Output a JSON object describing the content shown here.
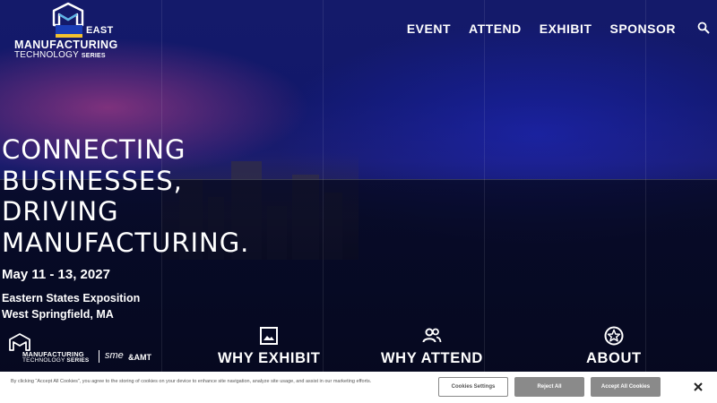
{
  "header": {
    "logo": {
      "badge": "EAST",
      "line1": "MANUFACTURING",
      "line2": "TECHNOLOGY",
      "line2_suffix": "SERIES"
    },
    "nav": [
      {
        "label": "EVENT"
      },
      {
        "label": "ATTEND"
      },
      {
        "label": "EXHIBIT"
      },
      {
        "label": "SPONSOR"
      }
    ],
    "search_icon": "search-icon"
  },
  "hero": {
    "headline": [
      "CONNECTING",
      "BUSINESSES,",
      "DRIVING",
      "MANUFACTURING."
    ],
    "dates": "May 11 - 13, 2027",
    "venue_line1": "Eastern States Exposition",
    "venue_line2": "West Springfield, MA"
  },
  "footer_logo": {
    "line1": "MANUFACTURING",
    "line2": "TECHNOLOGY",
    "line2_suffix": "SERIES",
    "partner1": "sme",
    "partner2": "&AMT"
  },
  "ctas": [
    {
      "label": "WHY EXHIBIT",
      "icon": "image-icon"
    },
    {
      "label": "WHY ATTEND",
      "icon": "people-icon"
    },
    {
      "label": "ABOUT",
      "icon": "star-badge-icon"
    }
  ],
  "cookie_banner": {
    "text": "By clicking “Accept All Cookies”, you agree to the storing of cookies on your device to enhance site navigation, analyze site usage, and assist in our marketing efforts.",
    "settings_label": "Cookies Settings",
    "reject_label": "Reject All",
    "accept_label": "Accept All Cookies"
  },
  "colors": {
    "hero_blue": "#141a6a",
    "accent_yellow": "#f2c230",
    "cookie_button_gray": "#8a8a8a"
  }
}
